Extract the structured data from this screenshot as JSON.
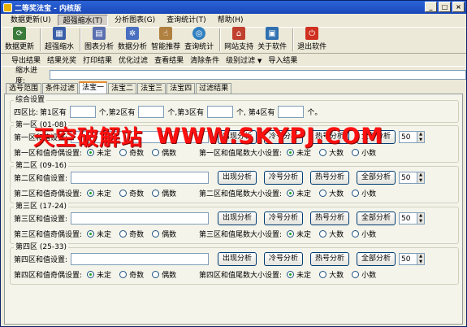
{
  "window": {
    "title": "二等奖法宝 - 内核版"
  },
  "menu": [
    {
      "label": "数据更新(U)"
    },
    {
      "label": "超强缩水(T)"
    },
    {
      "label": "分析图表(G)"
    },
    {
      "label": "查询统计(T)"
    },
    {
      "label": "帮助(H)"
    }
  ],
  "toolbar": [
    {
      "label": "数据更新",
      "icon": "database-refresh-icon",
      "color": "#3a7a3a"
    },
    {
      "label": "超强缩水",
      "icon": "grid-filter-icon",
      "color": "#3a5fa8"
    },
    {
      "label": "图表分析",
      "icon": "chart-document-icon",
      "color": "#5a6fb0"
    },
    {
      "label": "数据分析",
      "icon": "gear-icon",
      "color": "#4a6fc0"
    },
    {
      "label": "智能推荐",
      "icon": "hand-pointer-icon",
      "color": "#b08040"
    },
    {
      "label": "查询统计",
      "icon": "magnifier-globe-icon",
      "color": "#3080c0"
    },
    {
      "label": "网站支持",
      "icon": "house-icon",
      "color": "#c04030"
    },
    {
      "label": "关于软件",
      "icon": "computer-info-icon",
      "color": "#3070b0"
    },
    {
      "label": "退出软件",
      "icon": "power-icon",
      "color": "#d03020"
    }
  ],
  "subtoolbar": [
    {
      "label": "导出结果"
    },
    {
      "label": "结果兑奖"
    },
    {
      "label": "打印结果"
    },
    {
      "label": "优化过滤"
    },
    {
      "label": "查看结果"
    },
    {
      "label": "清除条件"
    },
    {
      "label": "级别过滤",
      "dropdown": "▼"
    },
    {
      "label": "导入结果"
    }
  ],
  "progress": {
    "label": "缩水进度:"
  },
  "tabs": [
    {
      "label": "选号范围"
    },
    {
      "label": "条件过滤"
    },
    {
      "label": "法宝一",
      "selected": true
    },
    {
      "label": "法宝二"
    },
    {
      "label": "法宝三"
    },
    {
      "label": "法宝四"
    },
    {
      "label": "过滤结果"
    }
  ],
  "overall": {
    "title": "综合设置",
    "prefix": "四区比:",
    "zone1": "第1区有",
    "zone2": "个,第2区有",
    "zone3": "个,第3区有",
    "zone4": "个,   第4区有",
    "suffix": "个。",
    "last_unit": "个。"
  },
  "zones": [
    {
      "title": "第一区 (01-08)",
      "sum_label": "第一区和值设置:",
      "oddeven_label": "第一区和值奇偶设置:",
      "bigsmall_label": "第一区和值尾数大小设置:",
      "spin": "50"
    },
    {
      "title": "第二区 (09-16)",
      "sum_label": "第二区和值设置:",
      "oddeven_label": "第二区和值奇偶设置:",
      "bigsmall_label": "第二区和值尾数大小设置:",
      "spin": "50"
    },
    {
      "title": "第三区 (17-24)",
      "sum_label": "第三区和值设置:",
      "oddeven_label": "第三区和值奇偶设置:",
      "bigsmall_label": "第三区和值尾数大小设置:",
      "spin": "50"
    },
    {
      "title": "第四区 (25-33)",
      "sum_label": "第四区和值设置:",
      "oddeven_label": "第四区和值奇偶设置:",
      "bigsmall_label": "第四区和值尾数大小设置:",
      "spin": "50"
    }
  ],
  "buttons": {
    "analyze": "出现分析",
    "cold": "冷号分析",
    "hot": "热号分析",
    "all": "全部分析"
  },
  "radios": {
    "unset": "未定",
    "odd": "奇数",
    "even": "偶数",
    "big": "大数",
    "small": "小数"
  },
  "watermark": {
    "cn": "天空破解站",
    "en": "WWW.SKYPJ.COM",
    "color": "#ff1010"
  }
}
